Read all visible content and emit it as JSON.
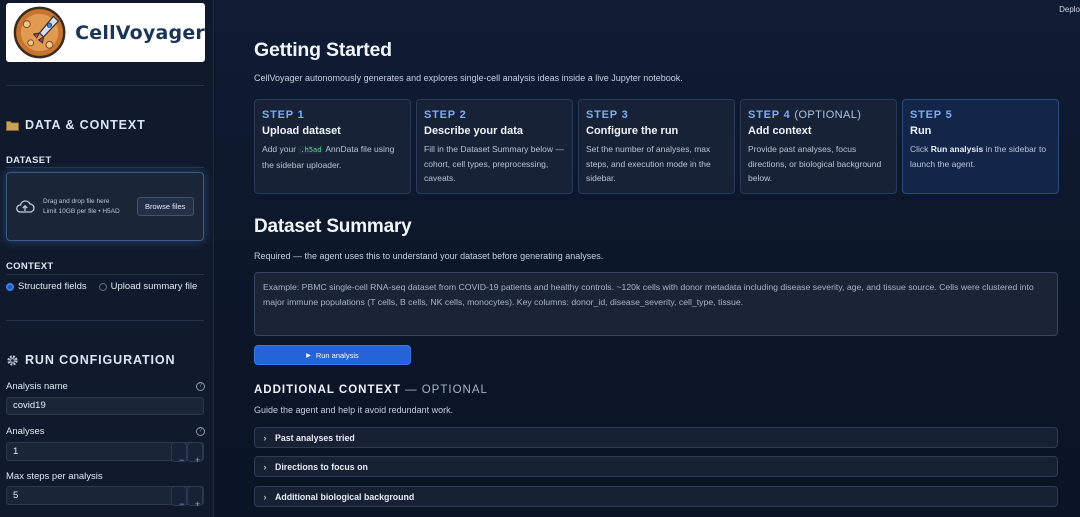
{
  "app": {
    "logo_text": "CellVoyager",
    "deploy_label": "Deplo"
  },
  "sidebar": {
    "data_section_title": "DATA & CONTEXT",
    "dataset_label": "DATASET",
    "dropzone": {
      "primary_text": "Drag and drop file here",
      "limit_text": "Limit 10GB per file • H5AD",
      "browse_button": "Browse files"
    },
    "context_label": "CONTEXT",
    "context_options": [
      {
        "label": "Structured fields",
        "selected": true
      },
      {
        "label": "Upload summary file",
        "selected": false
      }
    ],
    "run_section_title": "RUN CONFIGURATION",
    "analysis_name": {
      "label": "Analysis name",
      "value": "covid19"
    },
    "analyses": {
      "label": "Analyses",
      "value": "1"
    },
    "max_steps": {
      "label": "Max steps per analysis",
      "value": "5"
    },
    "stepper_minus": "−",
    "stepper_plus": "+",
    "help_glyph": "?"
  },
  "main": {
    "title": "Getting Started",
    "intro": "CellVoyager autonomously generates and explores single-cell analysis ideas inside a live Jupyter notebook.",
    "steps": [
      {
        "num": "STEP 1",
        "optional": "",
        "title": "Upload dataset",
        "desc_pre": "Add your ",
        "desc_code": ".h5ad",
        "desc_post": " AnnData file using the sidebar uploader."
      },
      {
        "num": "STEP 2",
        "optional": "",
        "title": "Describe your data",
        "desc": "Fill in the Dataset Summary below — cohort, cell types, preprocessing, caveats."
      },
      {
        "num": "STEP 3",
        "optional": "",
        "title": "Configure the run",
        "desc": "Set the number of analyses, max steps, and execution mode in the sidebar."
      },
      {
        "num": "STEP 4",
        "optional": "(OPTIONAL)",
        "title": "Add context",
        "desc": "Provide past analyses, focus directions, or biological background below."
      },
      {
        "num": "STEP 5",
        "optional": "",
        "title": "Run",
        "desc_pre": "Click ",
        "desc_bold": "Run analysis",
        "desc_post": " in the sidebar to launch the agent."
      }
    ],
    "summary_title": "Dataset Summary",
    "summary_note": "Required — the agent uses this to understand your dataset before generating analyses.",
    "summary_placeholder": "Example: PBMC single-cell RNA-seq dataset from COVID-19 patients and healthy controls. ~120k cells with donor metadata including disease severity, age, and tissue source. Cells were clustered into major immune populations (T cells, B cells, NK cells, monocytes). Key columns: donor_id, disease_severity, cell_type, tissue.",
    "run_button": "Run analysis",
    "run_icon": "▶",
    "additional_title": "ADDITIONAL CONTEXT",
    "additional_optional": "— OPTIONAL",
    "additional_note": "Guide the agent and help it avoid redundant work.",
    "expanders": [
      {
        "label": "Past analyses tried"
      },
      {
        "label": "Directions to focus on"
      },
      {
        "label": "Additional biological background"
      }
    ],
    "chevron": "›"
  },
  "colors": {
    "accent": "#2563d6",
    "step_number": "#78aef5",
    "background": "#0c1526",
    "sidebar": "#101a2c"
  }
}
